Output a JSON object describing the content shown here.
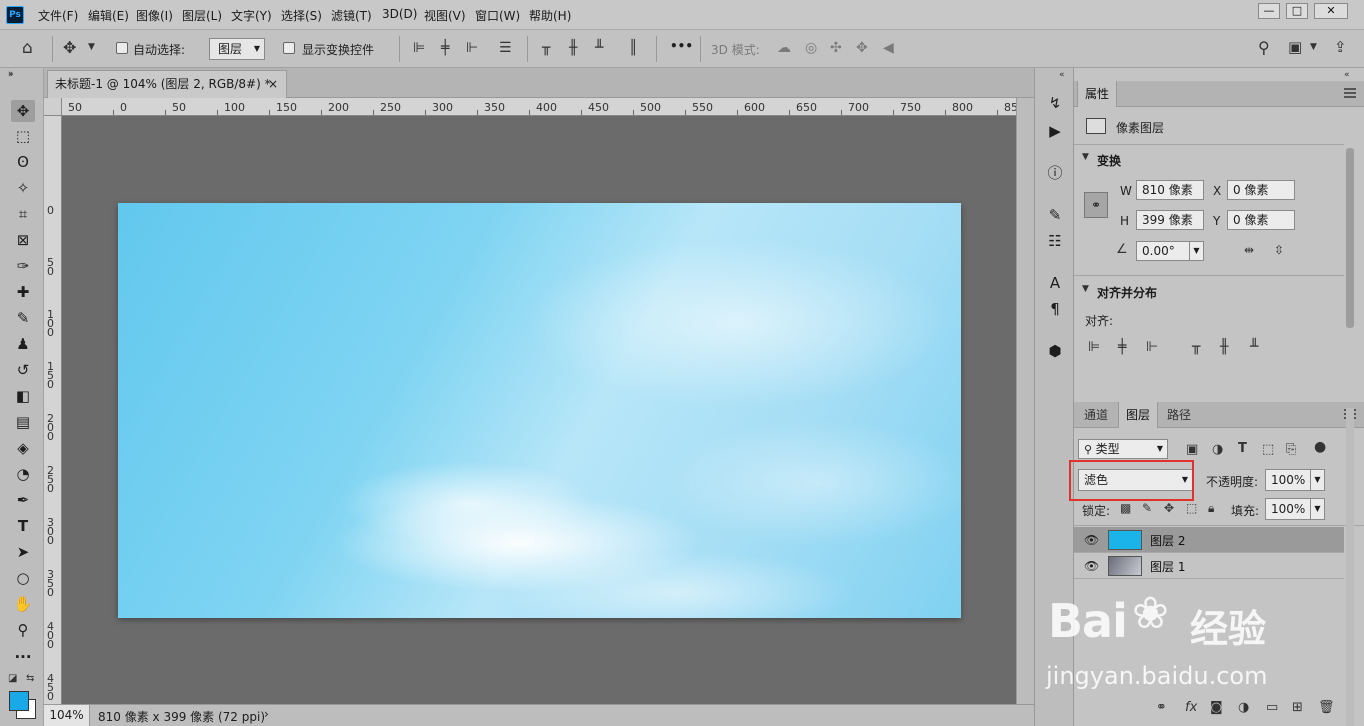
{
  "app": {
    "logo": "Ps"
  },
  "menu": [
    "文件(F)",
    "编辑(E)",
    "图像(I)",
    "图层(L)",
    "文字(Y)",
    "选择(S)",
    "滤镜(T)",
    "3D(D)",
    "视图(V)",
    "窗口(W)",
    "帮助(H)"
  ],
  "window_buttons": {
    "minimize": "—",
    "restore": "□",
    "close": "✕"
  },
  "options": {
    "auto_select_label": "自动选择:",
    "auto_select_value": "图层",
    "show_transform_label": "显示变换控件",
    "mode_3d_label": "3D 模式:",
    "more_label": "•••"
  },
  "document": {
    "tab_title": "未标题-1 @ 104% (图层 2, RGB/8#) *",
    "tab_close": "×"
  },
  "ruler_h": [
    "50",
    "0",
    "50",
    "100",
    "150",
    "200",
    "250",
    "300",
    "350",
    "400",
    "450",
    "500",
    "550",
    "600",
    "650",
    "700",
    "750",
    "800",
    "85"
  ],
  "ruler_v": [
    "0",
    "50",
    "100",
    "150",
    "200",
    "250",
    "300",
    "350",
    "400",
    "450"
  ],
  "status": {
    "zoom": "104%",
    "info": "810 像素 x 399 像素 (72 ppi)",
    "arrow": "›"
  },
  "properties": {
    "tab": "属性",
    "kind": "像素图层",
    "transform_title": "变换",
    "w_label": "W",
    "w_value": "810 像素",
    "h_label": "H",
    "h_value": "399 像素",
    "x_label": "X",
    "x_value": "0 像素",
    "y_label": "Y",
    "y_value": "0 像素",
    "angle_value": "0.00°",
    "align_title": "对齐并分布",
    "align_label": "对齐:"
  },
  "layers_panel": {
    "tabs": [
      "通道",
      "图层",
      "路径"
    ],
    "active_tab": "图层",
    "filter_kind": "类型",
    "blend_mode": "滤色",
    "opacity_label": "不透明度:",
    "opacity_value": "100%",
    "lock_label": "锁定:",
    "fill_label": "填充:",
    "fill_value": "100%",
    "layers": [
      {
        "name": "图层 2",
        "selected": true,
        "thumb_color": "#1ab3ea"
      },
      {
        "name": "图层 1",
        "selected": false,
        "thumb_color": "#6b6e7a"
      }
    ],
    "bottom_icons": [
      "link-icon",
      "fx-icon",
      "mask-icon",
      "adjustment-icon",
      "group-icon",
      "new-layer-icon",
      "delete-icon"
    ]
  },
  "colors": {
    "foreground": "#1aa9e8",
    "background": "#ffffff",
    "highlight": "#e0322d"
  },
  "watermark": {
    "brand": "Bai",
    "brand_suffix": "经验",
    "url": "jingyan.baidu.com"
  }
}
